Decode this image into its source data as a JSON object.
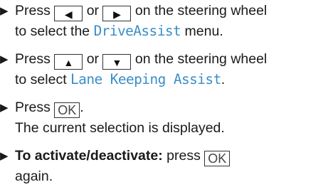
{
  "bullet_glyph": "▶",
  "key_glyphs": {
    "left": "◀",
    "right": "▶",
    "up": "▲",
    "down": "▼",
    "ok": "OK"
  },
  "colors": {
    "menu_text": "#3a8ec8",
    "body_text": "#1a1a1a"
  },
  "steps": [
    {
      "a": "Press",
      "or": "or",
      "b": "on the steering wheel",
      "c": "to select the",
      "menu": "DriveAssist",
      "d": "menu."
    },
    {
      "a": "Press",
      "or": "or",
      "b": "on the steering wheel",
      "c": "to select",
      "menu": "Lane Keeping Assist",
      "d": "."
    },
    {
      "a": "Press",
      "d": ".",
      "result": "The current selection is displayed."
    },
    {
      "bold": "To activate/deactivate:",
      "a": "press",
      "cont": "again."
    }
  ]
}
